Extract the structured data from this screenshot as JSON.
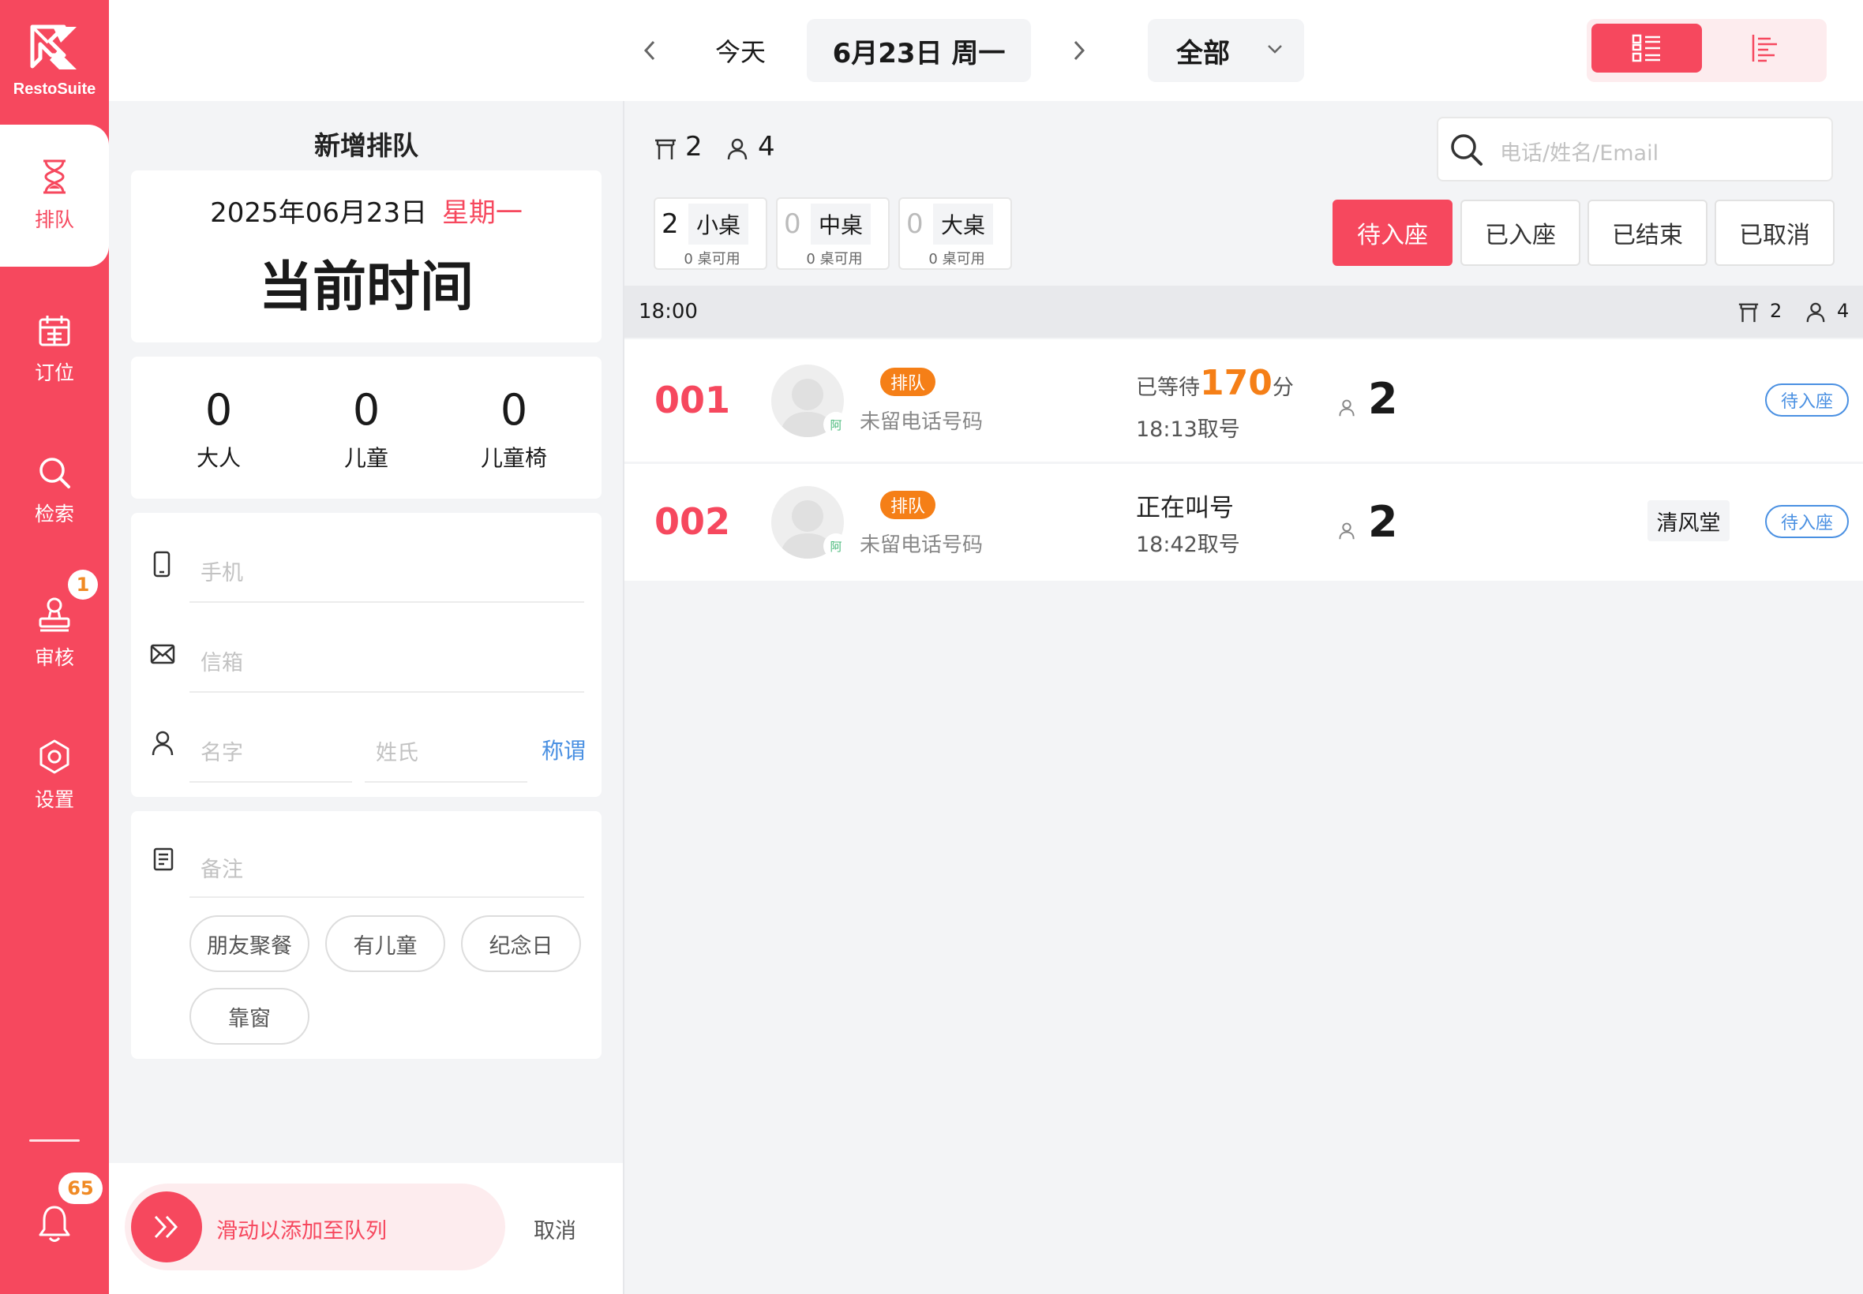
{
  "brand": {
    "name": "RestoSuite"
  },
  "colors": {
    "accent": "#f6485e",
    "orange": "#f57f17",
    "link": "#4a90e2"
  },
  "sidebar": {
    "items": [
      {
        "label": "排队",
        "icon": "hourglass-icon",
        "active": true
      },
      {
        "label": "订位",
        "icon": "calendar-icon"
      },
      {
        "label": "检索",
        "icon": "search-icon"
      },
      {
        "label": "审核",
        "icon": "stamp-icon",
        "badge": "1"
      },
      {
        "label": "设置",
        "icon": "settings-icon"
      }
    ],
    "notification_badge": "65"
  },
  "topbar": {
    "today": "今天",
    "date": "6月23日 周一",
    "filter": "全部"
  },
  "form": {
    "title": "新增排队",
    "date_text": "2025年06月23日",
    "weekday": "星期一",
    "current_time": "当前时间",
    "counts": [
      {
        "value": "0",
        "label": "大人"
      },
      {
        "value": "0",
        "label": "儿童"
      },
      {
        "value": "0",
        "label": "儿童椅"
      }
    ],
    "phone_placeholder": "手机",
    "email_placeholder": "信箱",
    "firstname_placeholder": "名字",
    "lastname_placeholder": "姓氏",
    "salutation": "称谓",
    "note_placeholder": "备注",
    "tags": [
      "朋友聚餐",
      "有儿童",
      "纪念日",
      "靠窗"
    ],
    "slide_label": "滑动以添加至队列",
    "cancel": "取消"
  },
  "summary": {
    "tables": "2",
    "people": "4"
  },
  "search": {
    "placeholder": "电话/姓名/Email"
  },
  "table_types": [
    {
      "count": "2",
      "name": "小桌",
      "avail": "0 桌可用"
    },
    {
      "count": "0",
      "name": "中桌",
      "avail": "0 桌可用"
    },
    {
      "count": "0",
      "name": "大桌",
      "avail": "0 桌可用"
    }
  ],
  "status_tabs": [
    "待入座",
    "已入座",
    "已结束",
    "已取消"
  ],
  "group": {
    "time": "18:00",
    "tables": "2",
    "people": "4"
  },
  "queue": [
    {
      "number": "001",
      "tag": "排队",
      "phone": "未留电话号码",
      "wait_prefix": "已等待",
      "wait_value": "170",
      "wait_unit": "分",
      "taken": "18:13取号",
      "party": "2",
      "area": "",
      "status": "待入座",
      "avatar_badge": "阿"
    },
    {
      "number": "002",
      "tag": "排队",
      "phone": "未留电话号码",
      "wait_prefix": "正在叫号",
      "wait_value": "",
      "wait_unit": "",
      "taken": "18:42取号",
      "party": "2",
      "area": "清风堂",
      "status": "待入座",
      "avatar_badge": "阿"
    }
  ]
}
